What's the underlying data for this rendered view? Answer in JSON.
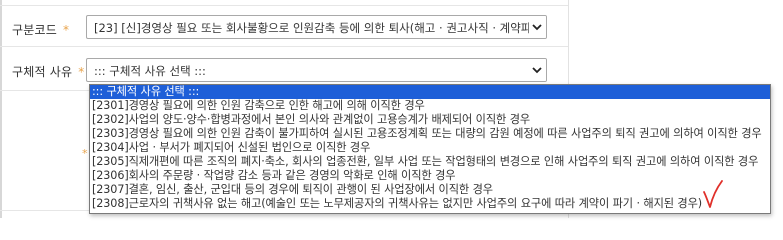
{
  "form": {
    "category_label": "구분코드",
    "category_value": "[23] [신]경영상 필요 또는 회사불황으로 인원감축 등에 의한 퇴사(해고 · 권고사직 · 계약파기",
    "reason_label": "구체적 사유",
    "reason_value": "::: 구체적 사유 선택 :::",
    "required_mark": "*"
  },
  "dropdown": {
    "options": [
      "::: 구체적 사유 선택 :::",
      "[2301]경영상 필요에 의한 인원 감축으로 인한 해고에 의해 이직한 경우",
      "[2302]사업의 양도·양수·합병과정에서 본인 의사와 관계없이 고용승계가 배제되어 이직한 경우",
      "[2303]경영상 필요에 의한 인원 감축이 불가피하여 실시된 고용조정계획 또는 대량의 감원 예정에 따른 사업주의 퇴직 권고에 의하여 이직한 경우",
      "[2304]사업 · 부서가 폐지되어 신설된 법인으로 이직한 경우",
      "[2305]직제개편에 따른 조직의 폐지·축소, 회사의 업종전환, 일부 사업 또는 작업형태의 변경으로 인해 사업주의 퇴직 권고에 의하여 이직한 경우",
      "[2306]회사의 주문량 · 작업량 감소 등과 같은 경영의 악화로 인해 이직한 경우",
      "[2307]결혼, 임신, 출산, 군입대 등의 경우에 퇴직이 관행이 된 사업장에서 이직한 경우",
      "[2308]근로자의 귀책사유 없는 해고(예술인 또는 노무제공자의 귀책사유는 없지만 사업주의 요구에 따라 계약이 파기 · 해지된 경우)"
    ],
    "selected_index": 0
  },
  "colors": {
    "selection": "#1e5fd8",
    "required": "#e8a34a",
    "annotation": "#e0302a"
  },
  "icons": {
    "dropdown_arrow": "chevron-down-icon",
    "annotation": "checkmark-annotation-icon"
  }
}
